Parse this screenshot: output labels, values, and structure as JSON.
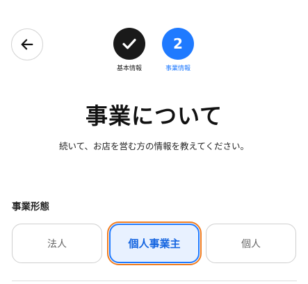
{
  "steps": [
    {
      "label": "基本情報",
      "status": "completed",
      "icon": "check-icon"
    },
    {
      "number": "2",
      "label": "事業情報",
      "status": "active"
    }
  ],
  "heading": {
    "title": "事業について",
    "subtitle": "続いて、お店を営む方の情報を教えてください。"
  },
  "business_type": {
    "label": "事業形態",
    "options": [
      {
        "label": "法人",
        "selected": false
      },
      {
        "label": "個人事業主",
        "selected": true
      },
      {
        "label": "個人",
        "selected": false
      }
    ]
  },
  "colors": {
    "accent": "#1f7aff",
    "completed": "#1a1a1a",
    "selected_bg": "#e8f1ff",
    "highlight": "#f07c1f"
  },
  "icons": {
    "back": "arrow-left-icon"
  }
}
